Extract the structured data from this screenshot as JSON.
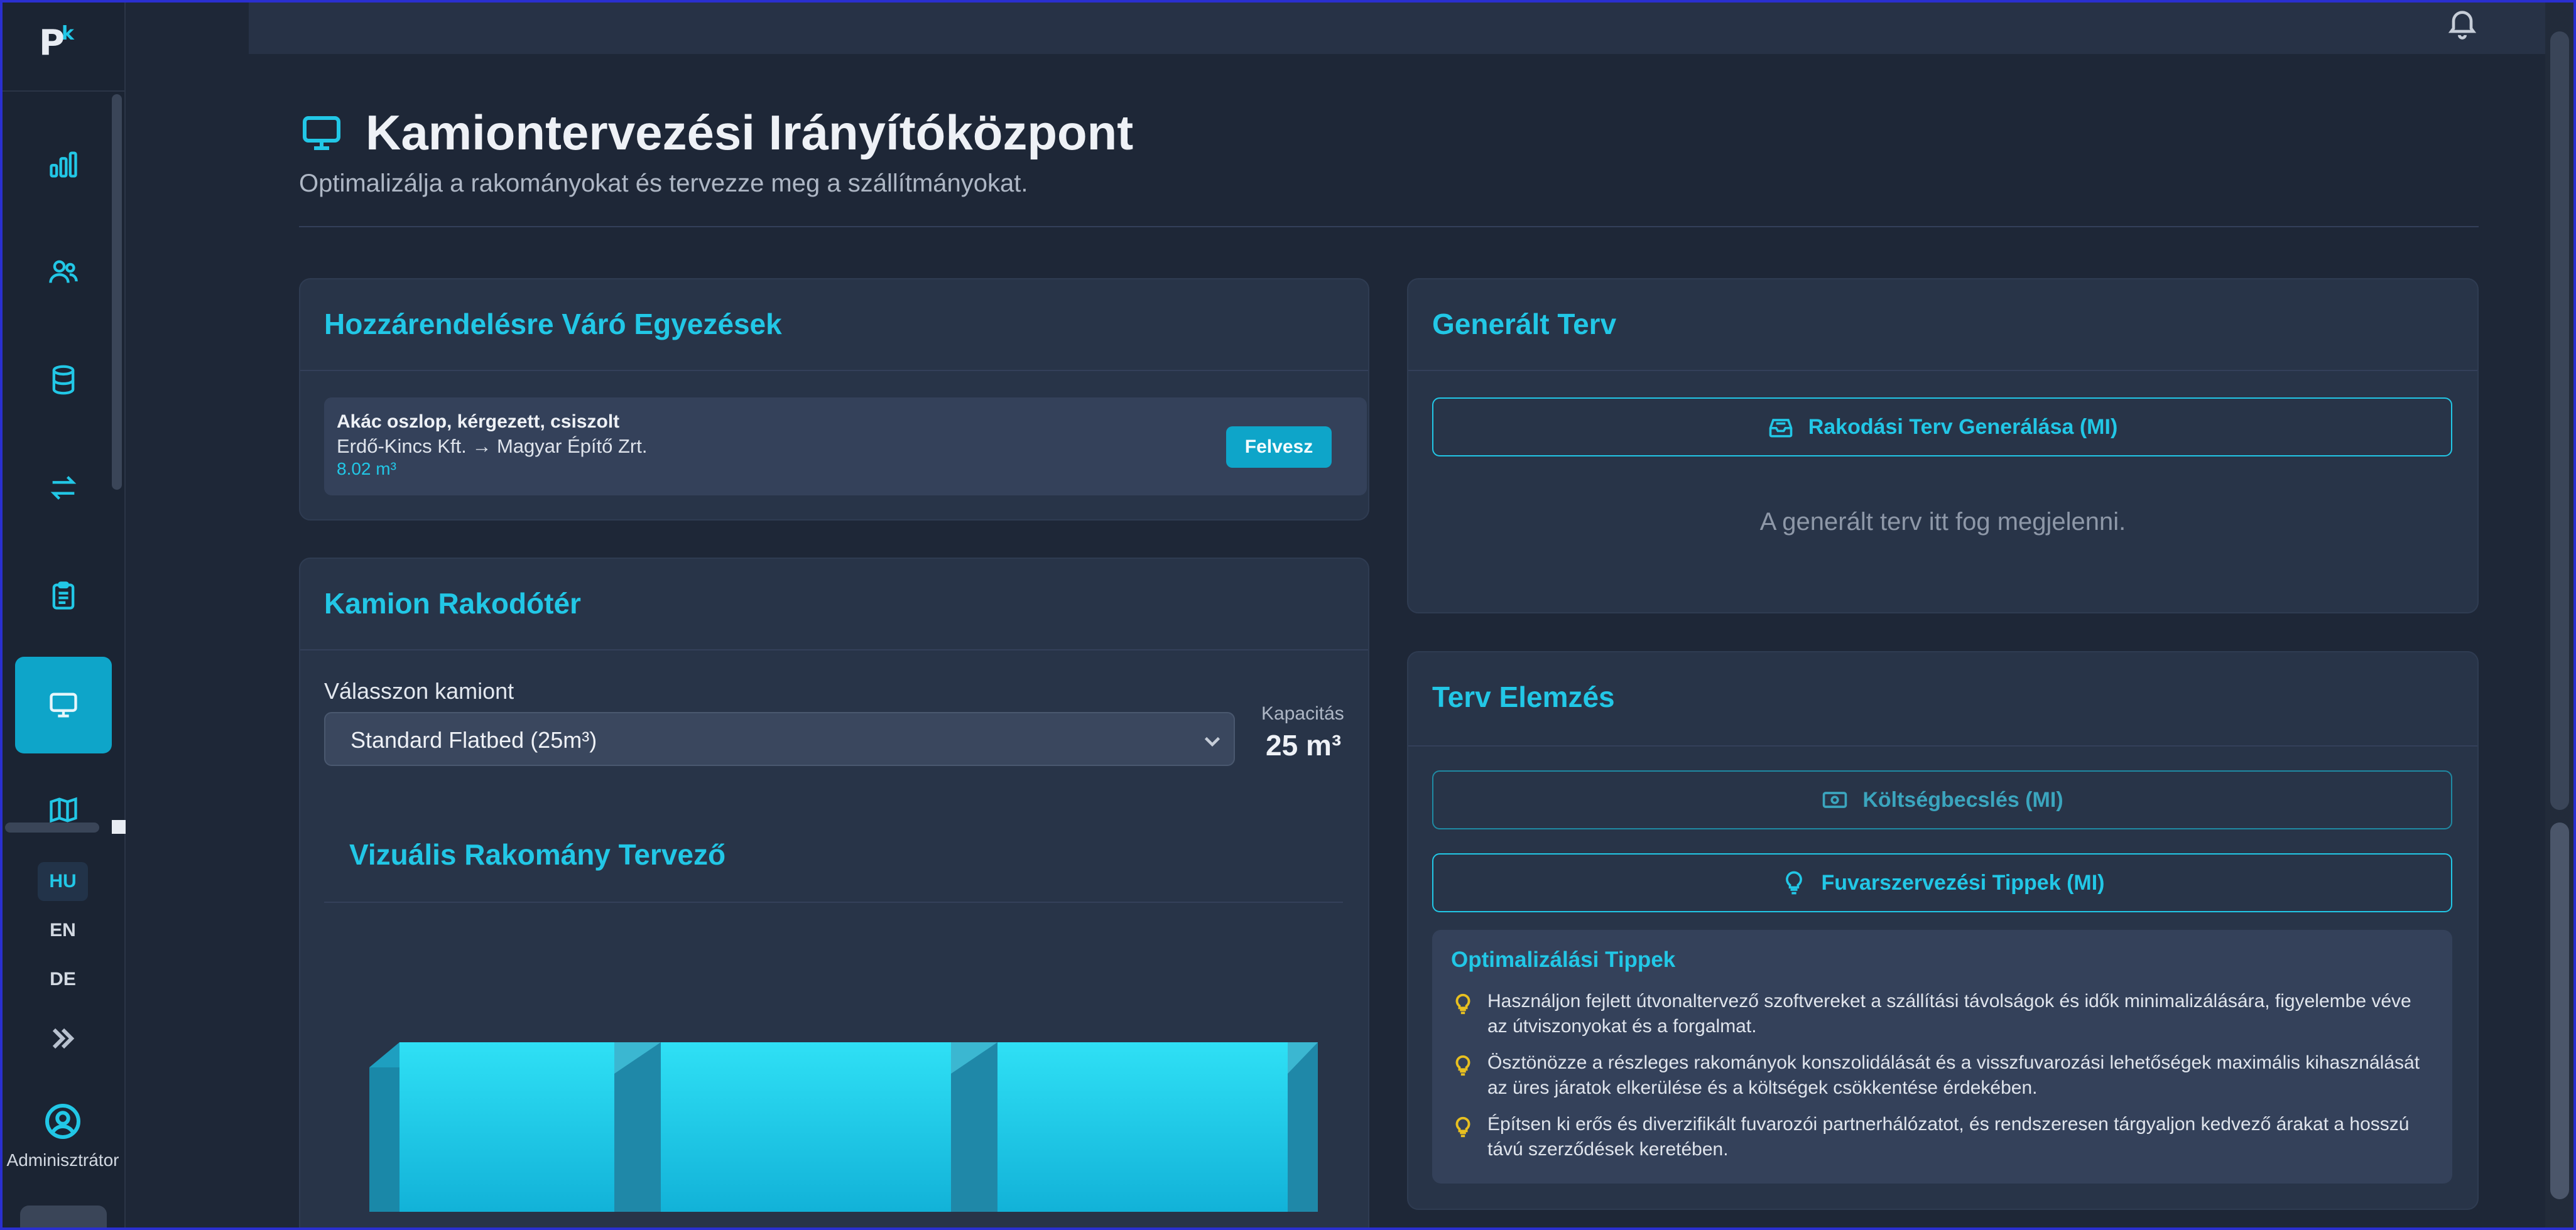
{
  "app": {
    "logo": "P",
    "logo_mark": "k",
    "title": "Kamiontervezési Irányítóközpont",
    "subtitle": "Optimalizálja a rakományokat és tervezze meg a szállítmányokat."
  },
  "sidebar": {
    "items": [
      {
        "icon": "bar-chart-icon",
        "active": false
      },
      {
        "icon": "users-icon",
        "active": false
      },
      {
        "icon": "database-icon",
        "active": false
      },
      {
        "icon": "transfer-icon",
        "active": false
      },
      {
        "icon": "clipboard-icon",
        "active": false
      },
      {
        "icon": "monitor-icon",
        "active": true
      },
      {
        "icon": "map-icon",
        "active": false
      }
    ],
    "languages": [
      "HU",
      "EN",
      "DE"
    ],
    "active_language": "HU",
    "admin_label": "Adminisztrátor"
  },
  "pending": {
    "title": "Hozzárendelésre Váró Egyezések",
    "items": [
      {
        "name": "Akác oszlop, kérgezett, csiszolt",
        "route": "Erdő-Kincs Kft. → Magyar Építő Zrt.",
        "volume": "8.02 m³",
        "action": "Felvesz"
      }
    ]
  },
  "truck": {
    "title": "Kamion Rakodótér",
    "select_label": "Válasszon kamiont",
    "selected": "Standard Flatbed (25m³)",
    "capacity_label": "Kapacitás",
    "capacity_value": "25 m³",
    "visual_title": "Vizuális Rakomány Tervező"
  },
  "plan": {
    "title": "Generált Terv",
    "generate_button": "Rakodási Terv Generálása (MI)",
    "placeholder": "A generált terv itt fog megjelenni."
  },
  "analysis": {
    "title": "Terv Elemzés",
    "cost_button": "Költségbecslés (MI)",
    "tips_button": "Fuvarszervezési Tippek (MI)",
    "tips_title": "Optimalizálási Tippek",
    "tips": [
      "Használjon fejlett útvonaltervező szoftvereket a szállítási távolságok és idők minimalizálására, figyelembe véve az útviszonyokat és a forgalmat.",
      "Ösztönözze a részleges rakományok konszolidálását és a visszfuvarozási lehetőségek maximális kihasználását az üres járatok elkerülése és a költségek csökkentése érdekében.",
      "Építsen ki erős és diverzifikált fuvarozói partnerhálózatot, és rendszeresen tárgyaljon kedvező árakat a hosszú távú szerződések keretében."
    ]
  },
  "colors": {
    "accent": "#22c7e6",
    "active_nav": "#0ea5c9",
    "background": "#1e2737",
    "card": "#283448",
    "tip_icon": "#e8c020"
  }
}
